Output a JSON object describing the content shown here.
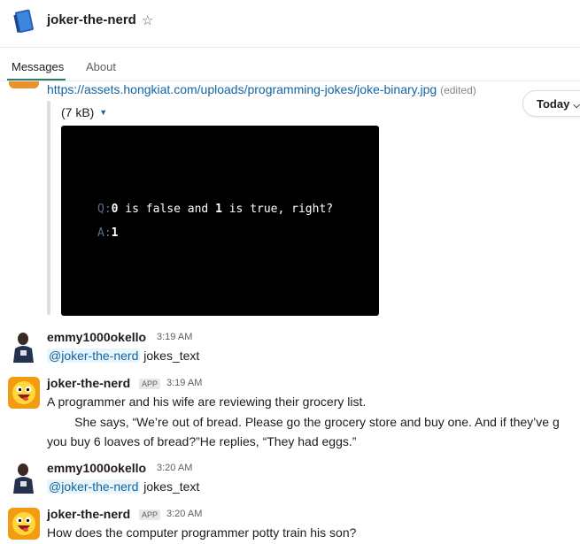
{
  "header": {
    "channel_name": "joker-the-nerd",
    "star_glyph": "☆",
    "app_icon": "notebook-icon"
  },
  "tabs": [
    {
      "label": "Messages",
      "active": true
    },
    {
      "label": "About",
      "active": false
    }
  ],
  "date_divider": {
    "label": "Today",
    "chevron": "⌄"
  },
  "file_message": {
    "link": "https://assets.hongkiat.com/uploads/programming-jokes/joke-binary.jpg",
    "edited": "(edited)",
    "size": "(7 kB)",
    "caret": "▼",
    "image": {
      "q_prefix": "Q:",
      "q_num1": "0",
      "q_mid": " is false and ",
      "q_num2": "1",
      "q_end": " is true, right?",
      "a_prefix": "A:",
      "a_value": "1"
    }
  },
  "messages": [
    {
      "sender": "emmy1000okello",
      "time": "3:19 AM",
      "mention": "@joker-the-nerd",
      "text": "jokes_text"
    },
    {
      "sender": "joker-the-nerd",
      "badge": "APP",
      "time": "3:19 AM",
      "lines": [
        "A programmer and his wife are reviewing their grocery list.",
        "        She says, “We’re out of bread. Please go the grocery store and buy one. And if they’ve g",
        "you buy 6 loaves of bread?”He replies, “They had eggs.”"
      ]
    },
    {
      "sender": "emmy1000okello",
      "time": "3:20 AM",
      "mention": "@joker-the-nerd",
      "text": "jokes_text"
    },
    {
      "sender": "joker-the-nerd",
      "badge": "APP",
      "time": "3:20 AM",
      "lines": [
        "How does the computer programmer potty train his son?"
      ]
    }
  ]
}
